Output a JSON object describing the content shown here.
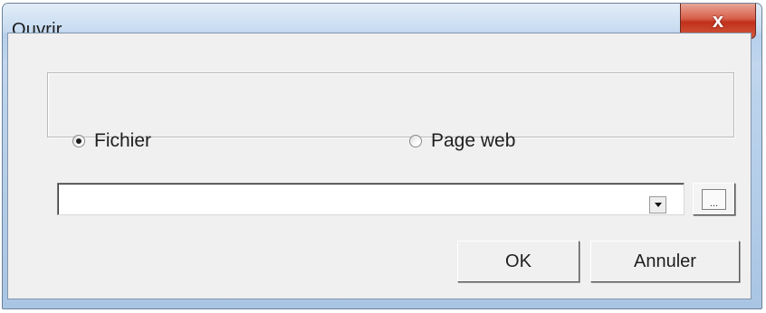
{
  "window": {
    "title": "Ouvrir",
    "close_glyph": "x",
    "close_icon": "close-icon",
    "accent_red": "#c1301b",
    "frame_blue": "#bcd3ec"
  },
  "source": {
    "options": [
      {
        "label": "Fichier",
        "checked": true
      },
      {
        "label": "Page web",
        "checked": false
      }
    ]
  },
  "path": {
    "value": "",
    "dropdown_icon": "chevron-down-icon",
    "browse_glyph": "..."
  },
  "buttons": {
    "ok_label": "OK",
    "cancel_label": "Annuler"
  }
}
